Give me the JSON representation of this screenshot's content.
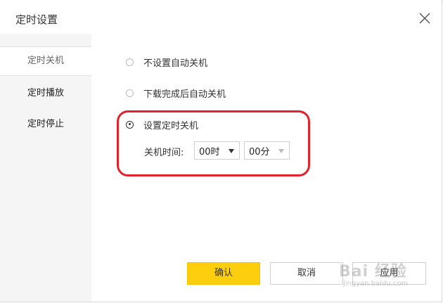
{
  "dialog": {
    "title": "定时设置"
  },
  "sidebar": {
    "items": [
      {
        "label": "定时关机"
      },
      {
        "label": "定时播放"
      },
      {
        "label": "定时停止"
      }
    ]
  },
  "options": {
    "no_auto_shutdown": "不设置自动关机",
    "shutdown_after_download": "下载完成后自动关机",
    "set_timed_shutdown": "设置定时关机",
    "selected": "set_timed_shutdown"
  },
  "shutdown_time": {
    "label": "关机时间:",
    "hour": "00时",
    "minute": "00分"
  },
  "buttons": {
    "ok": "确认",
    "cancel": "取消",
    "apply": "应用"
  },
  "watermark": {
    "text": "Bai 经验",
    "sub": "jingyan.baidu.com"
  },
  "colors": {
    "accent": "#fcce0d",
    "highlight": "#e3212b"
  }
}
